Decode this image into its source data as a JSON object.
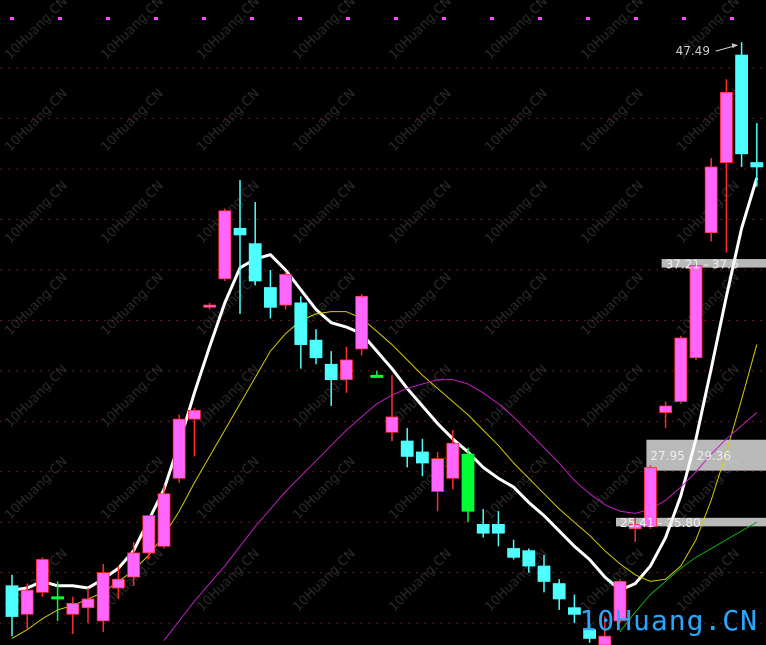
{
  "colors": {
    "background": "#000000",
    "grid": "#7a1010",
    "up_candle": "#ff66ff",
    "up_wick": "#ff2b2b",
    "down_candle": "#4dffff",
    "green_candle": "#00ff33",
    "ma_white": "#ffffff",
    "ma_yellow": "#d6cc00",
    "ma_purple": "#c020c0",
    "ma_green": "#11aa11",
    "zone": "#d9d9d9"
  },
  "watermark": "10Huang.CN",
  "brand": "10Huang.CN",
  "chart_data": {
    "type": "candlestick",
    "price_range": [
      20,
      48.5
    ],
    "grid_levels": [
      21.0,
      23.3,
      25.6,
      27.9,
      30.2,
      32.5,
      34.8,
      37.1,
      39.4,
      41.7,
      44.0,
      46.3
    ],
    "max_label": "47.49",
    "annotations": [
      {
        "text": "37.21 - 37.6",
        "low": 37.21,
        "high": 37.6
      },
      {
        "text": "27.95 - 29.36",
        "low": 27.95,
        "high": 29.36
      },
      {
        "text": "25.41 - 25.80",
        "low": 25.41,
        "high": 25.8
      }
    ],
    "candles": [
      {
        "o": 22.7,
        "h": 23.2,
        "l": 20.4,
        "c": 21.3,
        "color": "down"
      },
      {
        "o": 21.4,
        "h": 22.8,
        "l": 20.7,
        "c": 22.5,
        "color": "up"
      },
      {
        "o": 22.4,
        "h": 24.0,
        "l": 22.2,
        "c": 23.9,
        "color": "up"
      },
      {
        "o": 22.2,
        "h": 22.9,
        "l": 21.1,
        "c": 22.1,
        "color": "green"
      },
      {
        "o": 21.4,
        "h": 22.2,
        "l": 20.5,
        "c": 21.9,
        "color": "up"
      },
      {
        "o": 21.7,
        "h": 22.6,
        "l": 21.0,
        "c": 22.1,
        "color": "up"
      },
      {
        "o": 21.1,
        "h": 23.7,
        "l": 20.6,
        "c": 23.3,
        "color": "up"
      },
      {
        "o": 22.6,
        "h": 23.6,
        "l": 22.1,
        "c": 23.0,
        "color": "up"
      },
      {
        "o": 23.1,
        "h": 24.7,
        "l": 22.7,
        "c": 24.2,
        "color": "up"
      },
      {
        "o": 24.2,
        "h": 25.9,
        "l": 23.9,
        "c": 25.9,
        "color": "up"
      },
      {
        "o": 24.5,
        "h": 27.3,
        "l": 24.4,
        "c": 26.9,
        "color": "up"
      },
      {
        "o": 27.6,
        "h": 30.5,
        "l": 27.4,
        "c": 30.3,
        "color": "up"
      },
      {
        "o": 30.3,
        "h": 30.8,
        "l": 28.6,
        "c": 30.7,
        "color": "up"
      },
      {
        "o": 35.4,
        "h": 35.6,
        "l": 35.3,
        "c": 35.5,
        "color": "up"
      },
      {
        "o": 36.7,
        "h": 39.9,
        "l": 36.6,
        "c": 39.8,
        "color": "up"
      },
      {
        "o": 39.0,
        "h": 41.2,
        "l": 35.1,
        "c": 38.7,
        "color": "down"
      },
      {
        "o": 38.3,
        "h": 40.2,
        "l": 36.4,
        "c": 36.6,
        "color": "down"
      },
      {
        "o": 36.3,
        "h": 37.1,
        "l": 34.9,
        "c": 35.4,
        "color": "down"
      },
      {
        "o": 35.5,
        "h": 37.0,
        "l": 35.3,
        "c": 36.9,
        "color": "up"
      },
      {
        "o": 35.6,
        "h": 35.9,
        "l": 32.6,
        "c": 33.7,
        "color": "down"
      },
      {
        "o": 33.9,
        "h": 34.4,
        "l": 32.8,
        "c": 33.1,
        "color": "down"
      },
      {
        "o": 32.8,
        "h": 33.4,
        "l": 30.9,
        "c": 32.1,
        "color": "down"
      },
      {
        "o": 32.1,
        "h": 33.6,
        "l": 31.5,
        "c": 33.0,
        "color": "up"
      },
      {
        "o": 33.5,
        "h": 36.0,
        "l": 33.2,
        "c": 35.9,
        "color": "up"
      },
      {
        "o": 32.2,
        "h": 32.5,
        "l": 32.2,
        "c": 32.3,
        "color": "green"
      },
      {
        "o": 29.7,
        "h": 32.3,
        "l": 29.3,
        "c": 30.4,
        "color": "up"
      },
      {
        "o": 29.3,
        "h": 29.9,
        "l": 28.1,
        "c": 28.6,
        "color": "down"
      },
      {
        "o": 28.8,
        "h": 29.4,
        "l": 27.7,
        "c": 28.3,
        "color": "down"
      },
      {
        "o": 27.0,
        "h": 28.8,
        "l": 26.1,
        "c": 28.5,
        "color": "up"
      },
      {
        "o": 27.6,
        "h": 29.8,
        "l": 27.1,
        "c": 29.2,
        "color": "up"
      },
      {
        "o": 28.7,
        "h": 29.0,
        "l": 25.6,
        "c": 26.1,
        "color": "green"
      },
      {
        "o": 25.5,
        "h": 26.2,
        "l": 24.9,
        "c": 25.1,
        "color": "down"
      },
      {
        "o": 25.5,
        "h": 26.1,
        "l": 24.5,
        "c": 25.1,
        "color": "down"
      },
      {
        "o": 24.4,
        "h": 24.8,
        "l": 23.9,
        "c": 24.0,
        "color": "down"
      },
      {
        "o": 24.3,
        "h": 24.4,
        "l": 23.3,
        "c": 23.6,
        "color": "down"
      },
      {
        "o": 23.6,
        "h": 24.1,
        "l": 22.4,
        "c": 22.9,
        "color": "down"
      },
      {
        "o": 22.8,
        "h": 23.0,
        "l": 21.6,
        "c": 22.1,
        "color": "down"
      },
      {
        "o": 21.7,
        "h": 22.3,
        "l": 21.0,
        "c": 21.4,
        "color": "down"
      },
      {
        "o": 20.7,
        "h": 21.0,
        "l": 20.1,
        "c": 20.3,
        "color": "down"
      },
      {
        "o": 20.0,
        "h": 21.3,
        "l": 19.8,
        "c": 20.4,
        "color": "up"
      },
      {
        "o": 21.1,
        "h": 23.0,
        "l": 21.0,
        "c": 22.9,
        "color": "up"
      },
      {
        "o": 25.3,
        "h": 25.8,
        "l": 24.7,
        "c": 25.5,
        "color": "up"
      },
      {
        "o": 25.4,
        "h": 28.2,
        "l": 25.3,
        "c": 28.1,
        "color": "up"
      },
      {
        "o": 30.6,
        "h": 31.1,
        "l": 29.9,
        "c": 30.9,
        "color": "up"
      },
      {
        "o": 31.1,
        "h": 34.1,
        "l": 31.0,
        "c": 34.0,
        "color": "up"
      },
      {
        "o": 33.1,
        "h": 37.4,
        "l": 33.0,
        "c": 37.3,
        "color": "up"
      },
      {
        "o": 38.8,
        "h": 42.2,
        "l": 38.4,
        "c": 41.8,
        "color": "up"
      },
      {
        "o": 42.0,
        "h": 45.8,
        "l": 37.9,
        "c": 45.2,
        "color": "up"
      },
      {
        "o": 46.9,
        "h": 47.49,
        "l": 41.8,
        "c": 42.4,
        "color": "down"
      },
      {
        "o": 42.0,
        "h": 43.8,
        "l": 40.9,
        "c": 41.8,
        "color": "down"
      }
    ],
    "moving_averages": [
      {
        "color": "white",
        "width": 3,
        "values": [
          22.5,
          22.6,
          22.9,
          22.7,
          22.7,
          22.6,
          23.0,
          23.5,
          24.3,
          25.7,
          27.1,
          29.2,
          31.5,
          33.6,
          35.6,
          37.2,
          37.6,
          37.8,
          37.1,
          36.2,
          35.3,
          34.7,
          34.5,
          34.2,
          33.4,
          32.6,
          31.7,
          30.9,
          30.1,
          29.4,
          28.8,
          28.1,
          27.6,
          27.2,
          26.5,
          25.9,
          25.2,
          24.5,
          23.9,
          23.1,
          22.5,
          22.8,
          23.6,
          24.9,
          26.8,
          29.4,
          32.6,
          35.9,
          39.0,
          41.3
        ]
      },
      {
        "color": "yellow",
        "width": 1,
        "values": [
          20.3,
          20.7,
          21.2,
          21.6,
          21.8,
          22.1,
          22.4,
          22.9,
          23.4,
          24.1,
          25.0,
          26.1,
          27.4,
          28.6,
          29.8,
          31.0,
          32.2,
          33.4,
          34.2,
          34.8,
          35.1,
          35.2,
          35.2,
          34.9,
          34.3,
          33.7,
          33.0,
          32.3,
          31.7,
          31.1,
          30.5,
          29.8,
          29.1,
          28.3,
          27.6,
          26.9,
          26.2,
          25.6,
          25.0,
          24.3,
          23.7,
          23.2,
          22.9,
          23.0,
          23.6,
          24.8,
          26.6,
          28.8,
          31.2,
          33.7
        ]
      },
      {
        "color": "purple",
        "width": 1,
        "values": [
          null,
          null,
          null,
          null,
          null,
          null,
          null,
          null,
          null,
          null,
          20.2,
          21.1,
          22.0,
          22.8,
          23.6,
          24.5,
          25.4,
          26.2,
          27.0,
          27.7,
          28.4,
          29.1,
          29.8,
          30.4,
          31.0,
          31.4,
          31.7,
          31.9,
          32.1,
          32.1,
          31.9,
          31.5,
          31.0,
          30.4,
          29.7,
          29.0,
          28.3,
          27.5,
          26.9,
          26.4,
          26.1,
          26.0,
          26.2,
          26.6,
          27.2,
          27.9,
          28.7,
          29.4,
          30.0,
          30.6
        ]
      },
      {
        "color": "green",
        "width": 1,
        "values": [
          null,
          null,
          null,
          null,
          null,
          null,
          null,
          null,
          null,
          null,
          null,
          null,
          null,
          null,
          null,
          null,
          null,
          null,
          null,
          null,
          null,
          null,
          null,
          null,
          null,
          null,
          null,
          null,
          null,
          null,
          null,
          null,
          null,
          null,
          null,
          null,
          null,
          null,
          null,
          null,
          20.6,
          21.5,
          22.3,
          22.9,
          23.5,
          24.0,
          24.4,
          24.8,
          25.2,
          25.6
        ]
      }
    ]
  }
}
